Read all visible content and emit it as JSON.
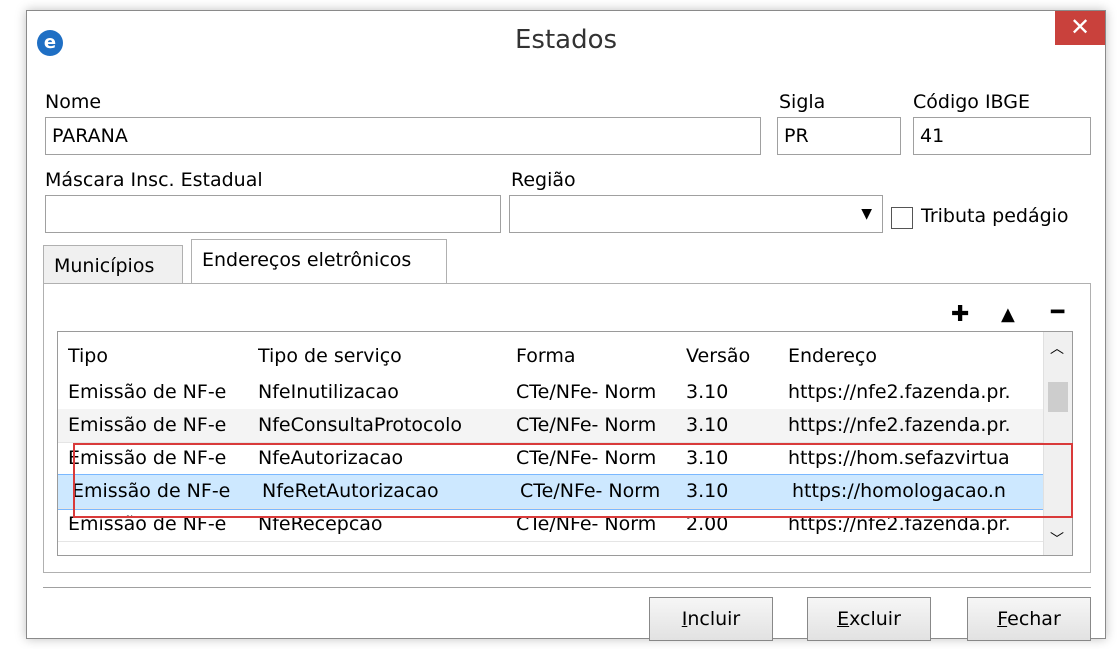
{
  "window": {
    "title": "Estados",
    "close_glyph": "✕",
    "app_icon": "e-logo-icon"
  },
  "form": {
    "nome_label": "Nome",
    "nome_value": "PARANA",
    "sigla_label": "Sigla",
    "sigla_value": "PR",
    "ibge_label": "Código IBGE",
    "ibge_value": "41",
    "mascara_label": "Máscara Insc. Estadual",
    "mascara_value": "",
    "regiao_label": "Região",
    "regiao_value": "",
    "tributa_label": "Tributa pedágio",
    "tributa_checked": false
  },
  "tabs": [
    {
      "label": "Municípios",
      "active": false
    },
    {
      "label": "Endereços eletrônicos",
      "active": true
    }
  ],
  "toolbar": {
    "add": "✚",
    "up": "▲",
    "remove": "━"
  },
  "grid": {
    "columns": [
      "Tipo",
      "Tipo de serviço",
      "Forma",
      "Versão",
      "Endereço"
    ],
    "rows": [
      [
        "Emissão de NF-e",
        "NfeInutilizacao",
        "CTe/NFe- Norm",
        "3.10",
        "https://nfe2.fazenda.pr."
      ],
      [
        "Emissão de NF-e",
        "NfeConsultaProtocolo",
        "CTe/NFe- Norm",
        "3.10",
        "https://nfe2.fazenda.pr."
      ],
      [
        "Emissão de NF-e",
        "NfeAutorizacao",
        "CTe/NFe- Norm",
        "3.10",
        "https://hom.sefazvirtua"
      ],
      [
        "Emissão de NF-e",
        "NfeRetAutorizacao",
        "CTe/NFe- Norm",
        "3.10",
        "https://homologacao.n"
      ],
      [
        "Emissão de NF-e",
        "NfeRecepcao",
        "CTe/NFe- Norm",
        "2.00",
        "https://nfe2.fazenda.pr."
      ]
    ],
    "selected_row": 3
  },
  "buttons": {
    "incluir_first": "I",
    "incluir_rest": "ncluir",
    "excluir_first": "E",
    "excluir_rest": "xcluir",
    "fechar_first": "F",
    "fechar_rest": "echar"
  },
  "colors": {
    "close": "#c9413c",
    "highlight": "#d93a3a",
    "selection": "#cde8ff",
    "app_icon": "#1f6fc4"
  }
}
